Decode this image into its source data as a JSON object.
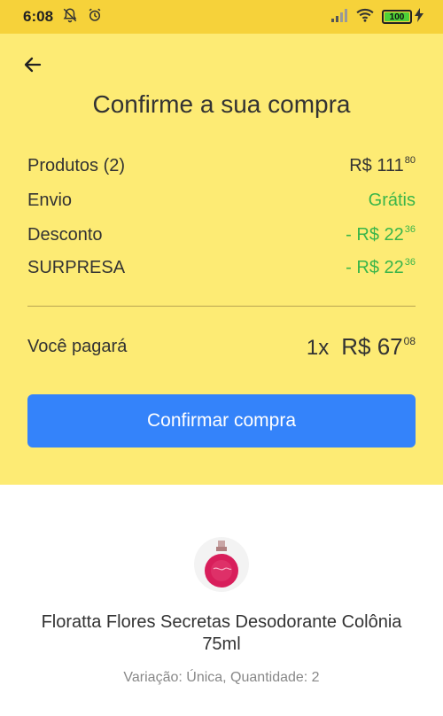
{
  "status_bar": {
    "time": "6:08",
    "battery": "100"
  },
  "header": {
    "title": "Confirme a sua compra"
  },
  "summary": {
    "products": {
      "label": "Produtos (2)",
      "amount": "R$ 111",
      "cents": "80"
    },
    "shipping": {
      "label": "Envio",
      "value": "Grátis"
    },
    "discount": {
      "label": "Desconto",
      "amount": "- R$ 22",
      "cents": "36"
    },
    "surprise": {
      "label": "SURPRESA",
      "amount": "- R$ 22",
      "cents": "36"
    },
    "total": {
      "label": "Você pagará",
      "quantity": "1x",
      "amount": "R$ 67",
      "cents": "08"
    }
  },
  "confirm_button": {
    "label": "Confirmar compra"
  },
  "product": {
    "title": "Floratta Flores Secretas Desodorante Colônia 75ml",
    "variation": "Variação: Única, Quantidade: 2"
  },
  "colors": {
    "status_bar": "#f6d23a",
    "header_bg": "#fdeb74",
    "primary_button": "#3483fa",
    "discount_green": "#39b54a"
  },
  "icons": {
    "back": "arrow-left-icon",
    "notifications_muted": "bell-off-icon",
    "alarm": "alarm-clock-icon",
    "signal": "signal-icon",
    "wifi": "wifi-icon",
    "charging": "bolt-icon"
  }
}
